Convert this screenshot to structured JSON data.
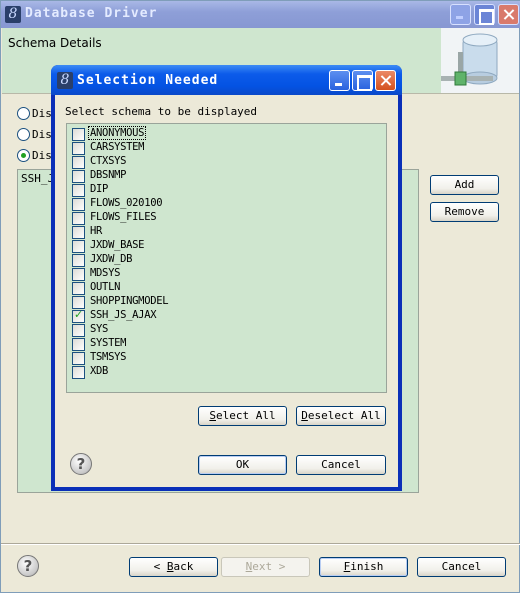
{
  "window": {
    "title": "Database Driver",
    "icon": "eclipse-8-icon",
    "controls": {
      "minimize": "minimize-icon",
      "maximize": "maximize-icon",
      "close": "close-icon"
    }
  },
  "banner": {
    "heading": "Schema Details",
    "art": "database-connection-icon"
  },
  "radios": [
    {
      "label": "Dis",
      "selected": false
    },
    {
      "label": "Dis",
      "selected": false
    },
    {
      "label": "Dis",
      "selected": true
    }
  ],
  "background_list": {
    "items": [
      "SSH_J"
    ]
  },
  "side_buttons": {
    "add": "Add",
    "remove": "Remove"
  },
  "footer": {
    "back": {
      "prefix": "< ",
      "mnemonic": "B",
      "rest": "ack"
    },
    "next": {
      "mnemonic": "N",
      "rest": "ext >",
      "enabled": false
    },
    "finish": {
      "mnemonic": "F",
      "rest": "inish"
    },
    "cancel": "Cancel",
    "help_icon": "help-icon"
  },
  "dialog": {
    "title": "Selection Needed",
    "prompt": "Select schema to be displayed",
    "schemas": [
      {
        "name": "ANONYMOUS",
        "checked": false,
        "focused": true
      },
      {
        "name": "CARSYSTEM",
        "checked": false
      },
      {
        "name": "CTXSYS",
        "checked": false
      },
      {
        "name": "DBSNMP",
        "checked": false
      },
      {
        "name": "DIP",
        "checked": false
      },
      {
        "name": "FLOWS_020100",
        "checked": false
      },
      {
        "name": "FLOWS_FILES",
        "checked": false
      },
      {
        "name": "HR",
        "checked": false
      },
      {
        "name": "JXDW_BASE",
        "checked": false
      },
      {
        "name": "JXDW_DB",
        "checked": false
      },
      {
        "name": "MDSYS",
        "checked": false
      },
      {
        "name": "OUTLN",
        "checked": false
      },
      {
        "name": "SHOPPINGMODEL",
        "checked": false
      },
      {
        "name": "SSH_JS_AJAX",
        "checked": true
      },
      {
        "name": "SYS",
        "checked": false
      },
      {
        "name": "SYSTEM",
        "checked": false
      },
      {
        "name": "TSMSYS",
        "checked": false
      },
      {
        "name": "XDB",
        "checked": false
      }
    ],
    "select_all": {
      "mnemonic": "S",
      "rest": "elect All"
    },
    "deselect_all": {
      "mnemonic": "D",
      "rest": "eselect All"
    },
    "ok": "OK",
    "cancel": "Cancel"
  },
  "colors": {
    "dialog_title": "#0453e3",
    "window_title": "#8e9fd8",
    "list_bg": "#cfe6cf",
    "face": "#ece9d8",
    "check": "#21a121"
  }
}
